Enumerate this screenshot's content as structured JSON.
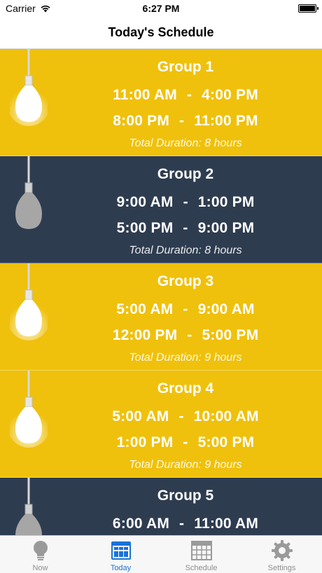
{
  "status": {
    "carrier": "Carrier",
    "time": "6:27 PM"
  },
  "header": {
    "title": "Today's Schedule"
  },
  "colors": {
    "on": "#efc10c",
    "off": "#2e3c50",
    "active_tab": "#1a73d9"
  },
  "groups": [
    {
      "name": "Group 1",
      "state": "on",
      "slots": [
        {
          "start": "11:00 AM",
          "end": "4:00 PM"
        },
        {
          "start": "8:00 PM",
          "end": "11:00 PM"
        }
      ],
      "duration": "Total Duration: 8 hours"
    },
    {
      "name": "Group 2",
      "state": "off",
      "slots": [
        {
          "start": "9:00 AM",
          "end": "1:00 PM"
        },
        {
          "start": "5:00 PM",
          "end": "9:00 PM"
        }
      ],
      "duration": "Total Duration: 8 hours"
    },
    {
      "name": "Group 3",
      "state": "on",
      "slots": [
        {
          "start": "5:00 AM",
          "end": "9:00 AM"
        },
        {
          "start": "12:00 PM",
          "end": "5:00 PM"
        }
      ],
      "duration": "Total Duration: 9 hours"
    },
    {
      "name": "Group 4",
      "state": "on",
      "slots": [
        {
          "start": "5:00 AM",
          "end": "10:00 AM"
        },
        {
          "start": "1:00 PM",
          "end": "5:00 PM"
        }
      ],
      "duration": "Total Duration: 9 hours"
    },
    {
      "name": "Group 5",
      "state": "off",
      "slots": [
        {
          "start": "6:00 AM",
          "end": "11:00 AM"
        },
        {
          "start": "",
          "end": ""
        }
      ],
      "duration": ""
    }
  ],
  "tabs": [
    {
      "label": "Now",
      "icon": "bulb-icon",
      "active": false
    },
    {
      "label": "Today",
      "icon": "today-icon",
      "active": true
    },
    {
      "label": "Schedule",
      "icon": "calendar-icon",
      "active": false
    },
    {
      "label": "Settings",
      "icon": "gear-icon",
      "active": false
    }
  ],
  "dash": "-"
}
